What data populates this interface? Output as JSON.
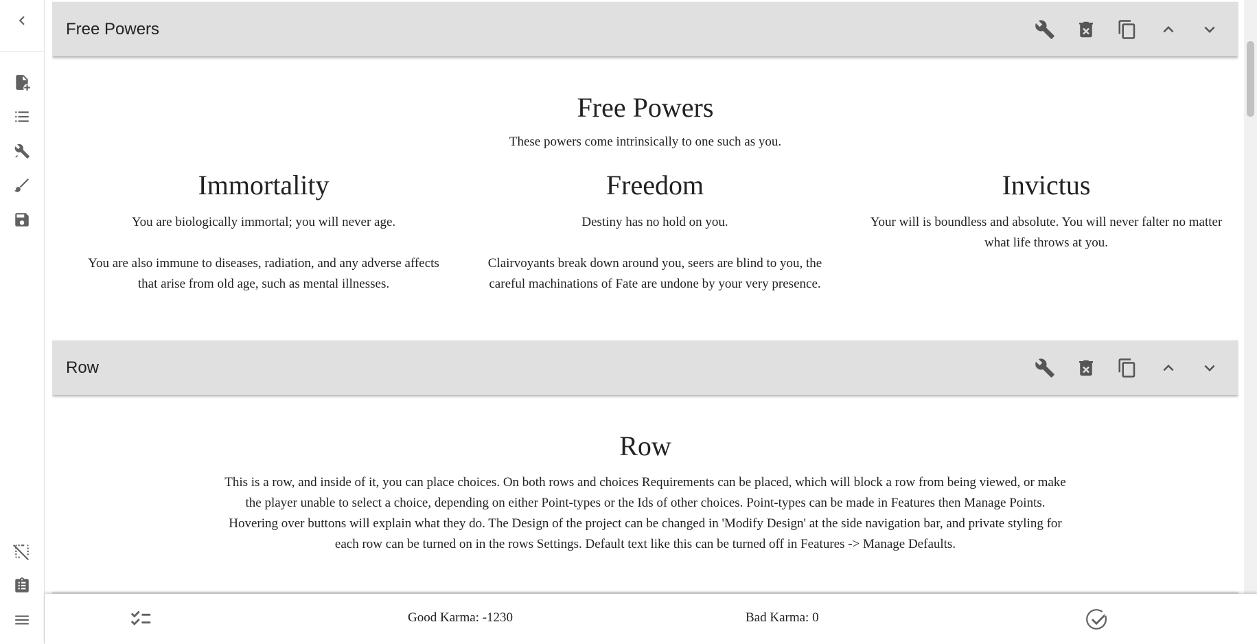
{
  "nav": {
    "items": [
      {
        "icon": "chevron-left-icon"
      },
      {
        "icon": "file-plus-icon"
      },
      {
        "icon": "list-icon"
      },
      {
        "icon": "tools-icon"
      },
      {
        "icon": "brush-icon"
      },
      {
        "icon": "save-icon"
      },
      {
        "icon": "select-off-icon"
      },
      {
        "icon": "clipboard-list-icon"
      },
      {
        "icon": "menu-icon"
      }
    ]
  },
  "rows": [
    {
      "bar_title": "Free Powers",
      "heading": "Free Powers",
      "subtitle": "These powers come intrinsically to one such as you.",
      "choices": [
        {
          "title": "Immortality",
          "text": "You are biologically immortal; you will never age.\n\nYou are also immune to diseases, radiation, and any adverse affects that arise from old age, such as mental illnesses."
        },
        {
          "title": "Freedom",
          "text": "Destiny has no hold on you.\n\nClairvoyants break down around you, seers are blind to you, the careful machinations of Fate are undone by your very presence."
        },
        {
          "title": "Invictus",
          "text": "Your will is boundless and absolute. You will never falter no matter what life throws at you."
        }
      ]
    },
    {
      "bar_title": "Row",
      "heading": "Row",
      "text": "This is a row, and inside of it, you can place choices. On both rows and choices Requirements can be placed, which will block a row from being viewed, or make the player unable to select a choice, depending on either Point-types or the Ids of other choices. Point-types can be made in Features then Manage Points. Hovering over buttons will explain what they do. The Design of the project can be changed in 'Modify Design' at the side navigation bar, and private styling for each row can be turned on in the rows Settings. Default text like this can be turned off in Features -> Manage Defaults."
    }
  ],
  "row_tools": [
    "wrench-icon",
    "delete-icon",
    "copy-icon",
    "chevron-up-icon",
    "chevron-down-icon"
  ],
  "bottom": {
    "left_icon": "checklist-icon",
    "good_karma": "Good Karma: -1230",
    "bad_karma": "Bad Karma: 0",
    "right_icon": "check-circle-icon"
  }
}
